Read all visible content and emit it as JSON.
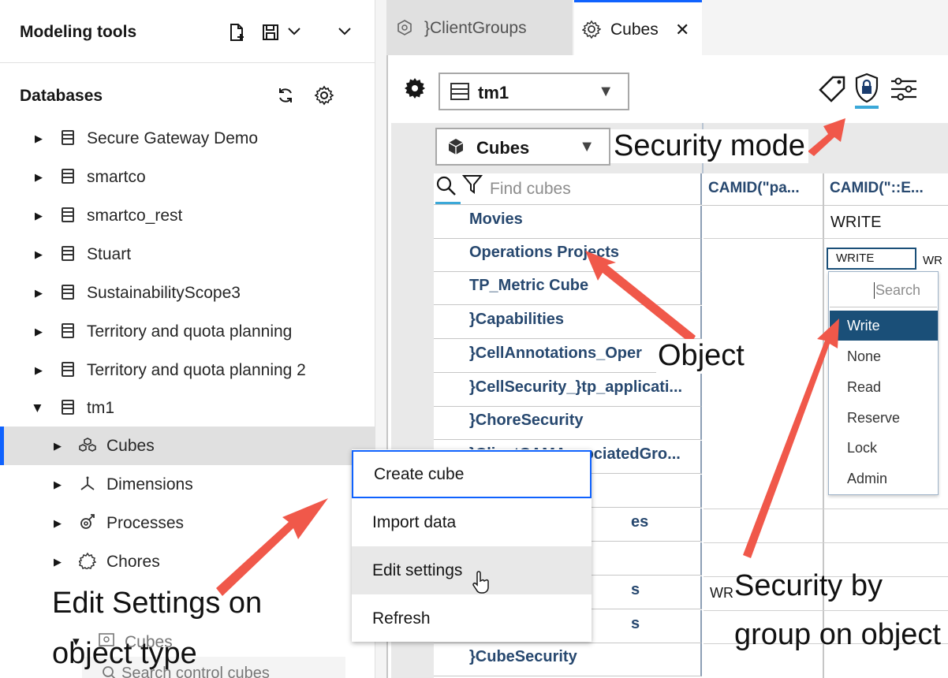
{
  "left_panel": {
    "title": "Modeling tools",
    "databases_title": "Databases",
    "databases": [
      {
        "label": "Secure Gateway Demo"
      },
      {
        "label": "smartco"
      },
      {
        "label": "smartco_rest"
      },
      {
        "label": "Stuart"
      },
      {
        "label": "SustainabilityScope3"
      },
      {
        "label": "Territory and quota planning"
      },
      {
        "label": "Territory and quota planning 2"
      },
      {
        "label": "tm1"
      }
    ],
    "tm1_children": [
      {
        "label": "Cubes",
        "icon": "cubes-icon"
      },
      {
        "label": "Dimensions",
        "icon": "dimensions-icon"
      },
      {
        "label": "Processes",
        "icon": "processes-icon"
      },
      {
        "label": "Chores",
        "icon": "chores-icon"
      }
    ],
    "control_cubes_label": "Cubes",
    "control_search_placeholder": "Search control cubes"
  },
  "tabs": [
    {
      "label": "}ClientGroups"
    },
    {
      "label": "Cubes",
      "closable": true
    }
  ],
  "toolbar": {
    "database_select": "tm1",
    "object_type_select": "Cubes",
    "find_placeholder": "Find cubes"
  },
  "grid": {
    "columns": [
      "CAMID(\"pa...",
      "CAMID(\"::E..."
    ],
    "rows": [
      {
        "name": "Movies",
        "col2": "WRITE"
      },
      {
        "name": "Operations Projects",
        "col2": "WRITE"
      },
      {
        "name": "TP_Metric Cube"
      },
      {
        "name": "}Capabilities"
      },
      {
        "name": "}CellAnnotations_Oper"
      },
      {
        "name": "}CellSecurity_}tp_applicati..."
      },
      {
        "name": "}ChoreSecurity"
      },
      {
        "name": "}ClientCAMAssociatedGro..."
      },
      {
        "name": ""
      },
      {
        "name": "es"
      },
      {
        "name": ""
      },
      {
        "name": "s",
        "col1": "WR"
      },
      {
        "name": "s"
      },
      {
        "name": "}CubeSecurity"
      }
    ],
    "partial_cell": "WR"
  },
  "security_dropdown": {
    "search_placeholder": "Search",
    "options": [
      "Write",
      "None",
      "Read",
      "Reserve",
      "Lock",
      "Admin"
    ],
    "selected": "Write"
  },
  "context_menu": {
    "items": [
      "Create cube",
      "Import data",
      "Edit settings",
      "Refresh"
    ]
  },
  "annotations": {
    "security_mode": "Security mode",
    "object": "Object",
    "edit_settings_line1": "Edit Settings on",
    "edit_settings_line2": "object type",
    "security_group_line1": "Security by",
    "security_group_line2": "group on object"
  },
  "colors": {
    "accent": "#0f62fe",
    "cube_link": "#27486f",
    "selected_option": "#1a4f78",
    "arrow": "#f0584a"
  }
}
